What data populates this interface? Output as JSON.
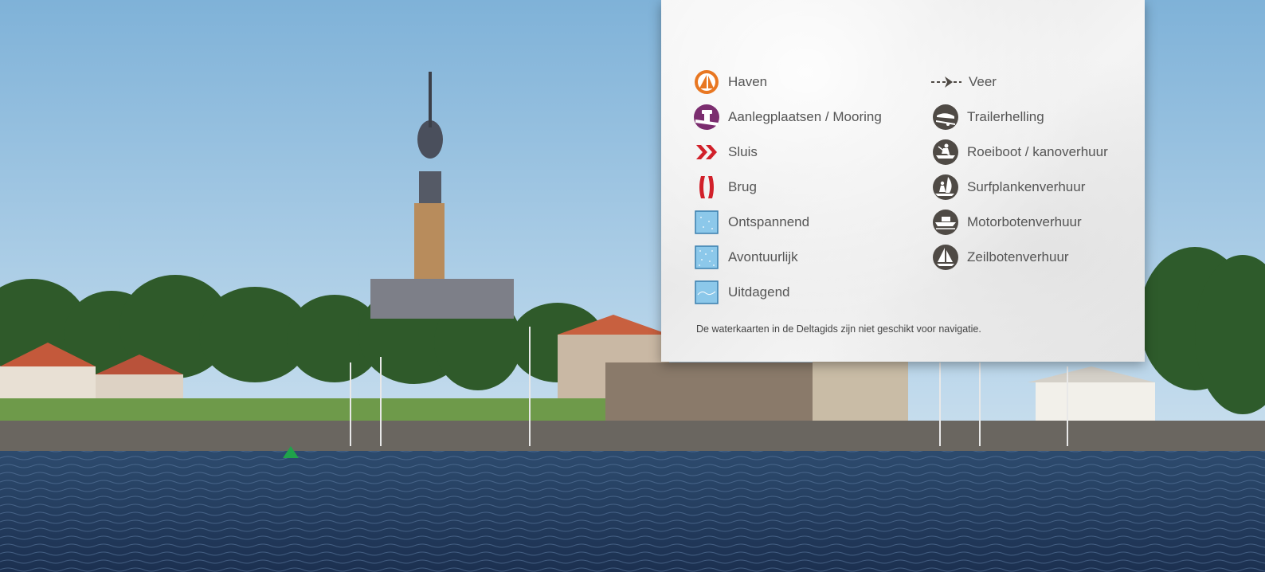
{
  "legend": {
    "items_left": [
      {
        "label": "Haven",
        "icon": "harbor-icon"
      },
      {
        "label": "Aanlegplaatsen / Mooring",
        "icon": "mooring-icon"
      },
      {
        "label": "Sluis",
        "icon": "lock-icon"
      },
      {
        "label": "Brug",
        "icon": "bridge-icon"
      },
      {
        "label": "Ontspannend",
        "icon": "relaxing-water-icon"
      },
      {
        "label": "Avontuurlijk",
        "icon": "adventurous-water-icon"
      },
      {
        "label": "Uitdagend",
        "icon": "challenging-water-icon"
      }
    ],
    "items_right": [
      {
        "label": "Veer",
        "icon": "ferry-icon"
      },
      {
        "label": "Trailerhelling",
        "icon": "trailer-ramp-icon"
      },
      {
        "label": "Roeiboot / kanoverhuur",
        "icon": "rowboat-canoe-rental-icon"
      },
      {
        "label": "Surfplankenverhuur",
        "icon": "surfboard-rental-icon"
      },
      {
        "label": "Motorbotenverhuur",
        "icon": "motorboat-rental-icon"
      },
      {
        "label": "Zeilbotenverhuur",
        "icon": "sailboat-rental-icon"
      }
    ],
    "disclaimer": "De waterkaarten in de Deltagids zijn niet geschikt voor navigatie."
  },
  "colors": {
    "harbor": "#e87722",
    "mooring": "#7b2d6f",
    "lock": "#d1202a",
    "bridge": "#d1202a",
    "water_zone": "#8cc8ea",
    "service_icon": "#4f4a45",
    "label_text": "#555555"
  }
}
